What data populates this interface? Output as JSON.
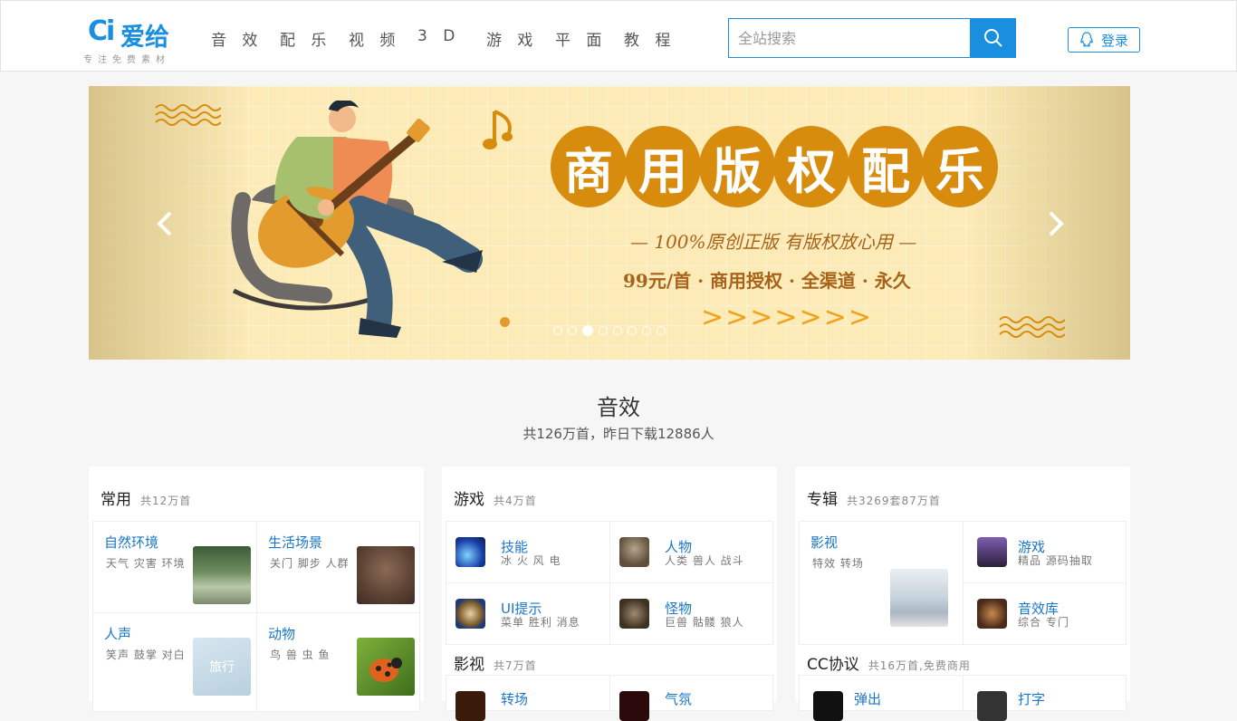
{
  "header": {
    "logo_mark": "Ci",
    "logo_name": "爱给",
    "slogan": "专注免费素材",
    "nav": [
      "音 效",
      "配 乐",
      "视 频",
      "3 D",
      "游 戏",
      "平 面",
      "教 程"
    ],
    "search": {
      "placeholder": "全站搜索",
      "value": ""
    },
    "login_label": "登录"
  },
  "banner": {
    "title_chars": [
      "商",
      "用",
      "版",
      "权",
      "配",
      "乐"
    ],
    "line1": "— 100%原创正版 有版权放心用 —",
    "line2": "99元/首 · 商用授权 · 全渠道 · 永久",
    "arrows": ">>>>>>>",
    "dots_total": 8,
    "active_dot": 3
  },
  "section": {
    "title": "音效",
    "subtitle": "共126万首，昨日下载12886人"
  },
  "cards": {
    "common": {
      "title": "常用",
      "count": "共12万首",
      "items": [
        {
          "title": "自然环境",
          "desc": "天气 灾害 环境",
          "thumb": "forest-path"
        },
        {
          "title": "生活场景",
          "desc": "关门 脚步 人群",
          "thumb": "footsteps"
        },
        {
          "title": "人声",
          "desc": "笑声 鼓掌 对白",
          "thumb": "sky",
          "overlay": "旅行"
        },
        {
          "title": "动物",
          "desc": "鸟 兽 虫 鱼",
          "thumb": "ladybug"
        }
      ]
    },
    "game": {
      "title": "游戏",
      "count": "共4万首",
      "items": [
        {
          "title": "技能",
          "desc": "冰 火 风 电",
          "icon": "skill-icon"
        },
        {
          "title": "人物",
          "desc": "人类 兽人 战斗",
          "icon": "character-icon"
        },
        {
          "title": "UI提示",
          "desc": "菜单 胜利 消息",
          "icon": "ui-icon"
        },
        {
          "title": "怪物",
          "desc": "巨兽 骷髅 狼人",
          "icon": "monster-icon"
        }
      ],
      "sub": {
        "title": "影视",
        "count": "共7万首",
        "items": [
          "转场",
          "气氛"
        ]
      }
    },
    "album": {
      "title": "专辑",
      "count": "共3269套87万首",
      "items": [
        {
          "title": "影视",
          "desc": "特效 转场",
          "thumb": "misty-landscape"
        },
        {
          "title": "游戏",
          "desc": "精品 源码抽取",
          "icon": "game-album-icon"
        },
        {
          "title": "音效库",
          "desc": "综合 专门",
          "icon": "library-icon"
        }
      ],
      "sub": {
        "title": "CC协议",
        "count": "共16万首,免费商用",
        "items": [
          "弹出",
          "打字"
        ]
      }
    }
  },
  "colors": {
    "accent": "#1a8fe0",
    "banner_orange": "#d88c0d",
    "link": "#1a76c8"
  }
}
